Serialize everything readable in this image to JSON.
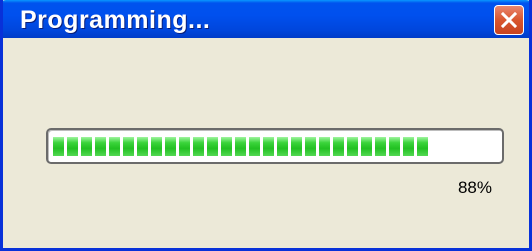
{
  "window": {
    "title": "Programming..."
  },
  "progress": {
    "value_percent": 88,
    "label": "88%"
  },
  "colors": {
    "titlebar": "#0053ee",
    "progress_fill": "#22c022",
    "close_button": "#d9562e"
  },
  "icons": {
    "close": "close-icon"
  }
}
